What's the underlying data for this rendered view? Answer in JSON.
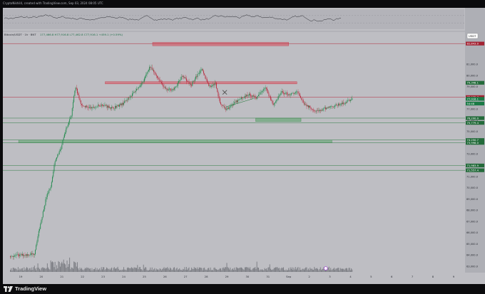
{
  "header": {
    "credit": "CryptoNikhil4, created with TradingView.com, Sep 03, 2024 08:05 UTC"
  },
  "footer": {
    "logo_text": "TradingView"
  },
  "chart_data": {
    "type": "candlestick",
    "title": "",
    "symbol_legend": "Bitcoin/USDT · 1h · BNT",
    "ohlc_legend": "177,466.8  H77,916.8  L77,462.8  C77,916.1  +459.1 (+0.59%)",
    "currency_badge": "USDT",
    "x_ticks": [
      "19",
      "20",
      "21",
      "22",
      "23",
      "24",
      "25",
      "26",
      "27",
      "28",
      "29",
      "30",
      "31",
      "Sep",
      "2",
      "3",
      "4",
      "5",
      "6",
      "7",
      "8",
      "9"
    ],
    "y_ticks": [
      "81,000.0",
      "80,000.0",
      "79,000.0",
      "78,000.0",
      "77,000.0",
      "76,000.0",
      "75,000.0",
      "74,000.0",
      "73,000.0",
      "72,000.0",
      "71,000.0",
      "70,000.0",
      "69,000.0",
      "68,000.0",
      "67,000.0",
      "66,000.0",
      "65,000.0",
      "64,000.0",
      "63,000.0"
    ],
    "ylim": [
      62500,
      83300
    ],
    "price_labels": [
      {
        "text": "82,843.0",
        "value": 82843,
        "kind": "resistance"
      },
      {
        "text": "79,348.1",
        "value": 79348,
        "kind": "support"
      },
      {
        "text": "78,075.7",
        "value": 78075,
        "kind": "resistance"
      },
      {
        "text": "77,916.1",
        "value": 77916,
        "kind": "last"
      },
      {
        "text": "54:48",
        "value": 77500,
        "kind": "timer"
      },
      {
        "text": "76,200.0",
        "value": 76200,
        "kind": "support"
      },
      {
        "text": "75,779.4",
        "value": 75779,
        "kind": "support"
      },
      {
        "text": "74,250.7",
        "value": 74250,
        "kind": "support"
      },
      {
        "text": "73,998.0",
        "value": 73998,
        "kind": "support"
      },
      {
        "text": "71,983.9",
        "value": 71983,
        "kind": "support"
      },
      {
        "text": "71,557.4",
        "value": 71557,
        "kind": "support"
      }
    ],
    "zones": [
      {
        "kind": "resistance",
        "y_top": 82950,
        "y_bot": 82650,
        "x_start_day": 24.9,
        "x_end_day": 31.5
      },
      {
        "kind": "resistance",
        "y_top": 79450,
        "y_bot": 79250,
        "x_start_day": 22.6,
        "x_end_day": 31.9
      },
      {
        "kind": "support",
        "y_top": 76200,
        "y_bot": 75900,
        "x_start_day": 29.9,
        "x_end_day": 32.1
      },
      {
        "kind": "support",
        "y_top": 74250,
        "y_bot": 74000,
        "x_start_day": 18.4,
        "x_end_day": 33.6
      }
    ],
    "levels": [
      {
        "value": 82843,
        "kind": "resistance"
      },
      {
        "value": 78075,
        "kind": "resistance"
      },
      {
        "value": 76200,
        "kind": "support"
      },
      {
        "value": 75779,
        "kind": "support"
      },
      {
        "value": 74250,
        "kind": "support"
      },
      {
        "value": 73998,
        "kind": "support"
      },
      {
        "value": 71983,
        "kind": "support"
      },
      {
        "value": 71557,
        "kind": "support"
      }
    ],
    "path_waypoints": [
      {
        "d": 18.0,
        "p": 63900
      },
      {
        "d": 19.2,
        "p": 64100
      },
      {
        "d": 19.5,
        "p": 66800
      },
      {
        "d": 19.8,
        "p": 69300
      },
      {
        "d": 20.0,
        "p": 70000
      },
      {
        "d": 20.2,
        "p": 72400
      },
      {
        "d": 20.5,
        "p": 73500
      },
      {
        "d": 20.7,
        "p": 75000
      },
      {
        "d": 21.0,
        "p": 76500
      },
      {
        "d": 21.2,
        "p": 79000
      },
      {
        "d": 21.5,
        "p": 77300
      },
      {
        "d": 22.0,
        "p": 77100
      },
      {
        "d": 22.5,
        "p": 77400
      },
      {
        "d": 23.0,
        "p": 77100
      },
      {
        "d": 23.5,
        "p": 77500
      },
      {
        "d": 24.0,
        "p": 78400
      },
      {
        "d": 24.5,
        "p": 79500
      },
      {
        "d": 24.8,
        "p": 80800
      },
      {
        "d": 25.2,
        "p": 79800
      },
      {
        "d": 25.6,
        "p": 78700
      },
      {
        "d": 26.0,
        "p": 78800
      },
      {
        "d": 26.4,
        "p": 80000
      },
      {
        "d": 26.8,
        "p": 79100
      },
      {
        "d": 27.3,
        "p": 80600
      },
      {
        "d": 27.7,
        "p": 79000
      },
      {
        "d": 28.0,
        "p": 79300
      },
      {
        "d": 28.2,
        "p": 77600
      },
      {
        "d": 28.5,
        "p": 77000
      },
      {
        "d": 28.8,
        "p": 77400
      },
      {
        "d": 29.2,
        "p": 77900
      },
      {
        "d": 29.6,
        "p": 78300
      },
      {
        "d": 30.0,
        "p": 78000
      },
      {
        "d": 30.4,
        "p": 79000
      },
      {
        "d": 30.8,
        "p": 77400
      },
      {
        "d": 31.2,
        "p": 78500
      },
      {
        "d": 31.6,
        "p": 78300
      },
      {
        "d": 32.0,
        "p": 78500
      },
      {
        "d": 32.3,
        "p": 77500
      },
      {
        "d": 32.7,
        "p": 77000
      },
      {
        "d": 33.0,
        "p": 76800
      },
      {
        "d": 33.5,
        "p": 77200
      },
      {
        "d": 34.0,
        "p": 77400
      },
      {
        "d": 34.3,
        "p": 77600
      },
      {
        "d": 34.6,
        "p": 77900
      }
    ],
    "rsi_panel": {
      "levels": [
        60,
        40
      ]
    }
  }
}
